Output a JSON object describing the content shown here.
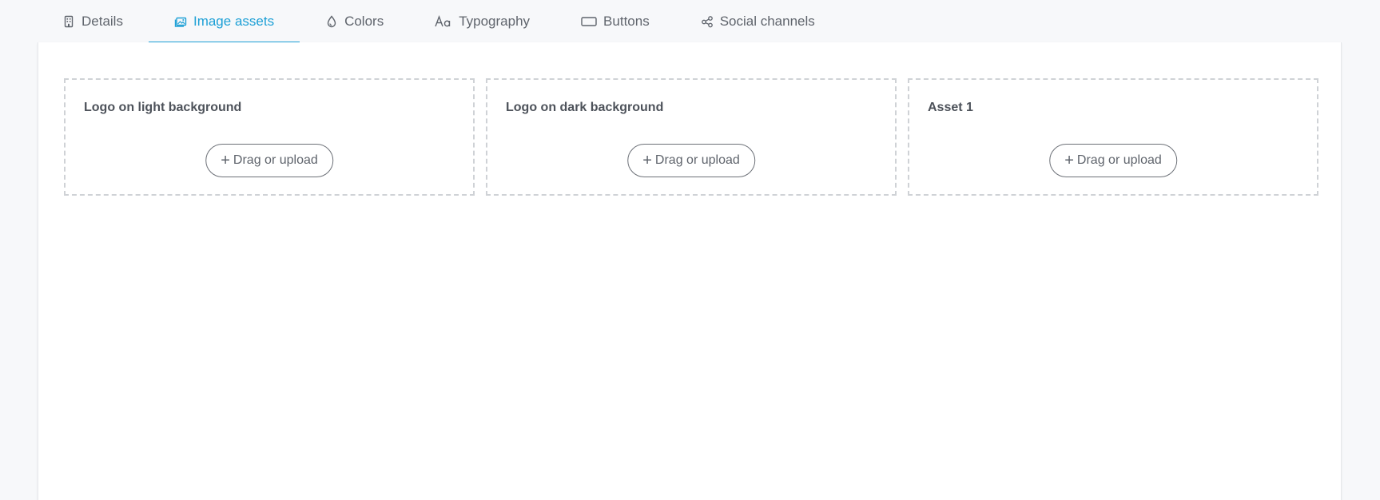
{
  "tabs": [
    {
      "label": "Details",
      "icon": "building-icon",
      "active": false
    },
    {
      "label": "Image assets",
      "icon": "image-icon",
      "active": true
    },
    {
      "label": "Colors",
      "icon": "droplet-icon",
      "active": false
    },
    {
      "label": "Typography",
      "icon": "typography-icon",
      "active": false
    },
    {
      "label": "Buttons",
      "icon": "button-icon",
      "active": false
    },
    {
      "label": "Social channels",
      "icon": "share-icon",
      "active": false
    }
  ],
  "cards": [
    {
      "title": "Logo on light background",
      "button_label": "Drag or upload",
      "button_icon": "plus-icon"
    },
    {
      "title": "Logo on dark background",
      "button_label": "Drag or upload",
      "button_icon": "plus-icon"
    },
    {
      "title": "Asset 1",
      "button_label": "Drag or upload",
      "button_icon": "plus-icon"
    }
  ],
  "colors": {
    "accent": "#1ea0d6",
    "text": "#5f646c",
    "background": "#f7f8fa",
    "panel": "#ffffff",
    "dashed_border": "#cfd2d6"
  }
}
